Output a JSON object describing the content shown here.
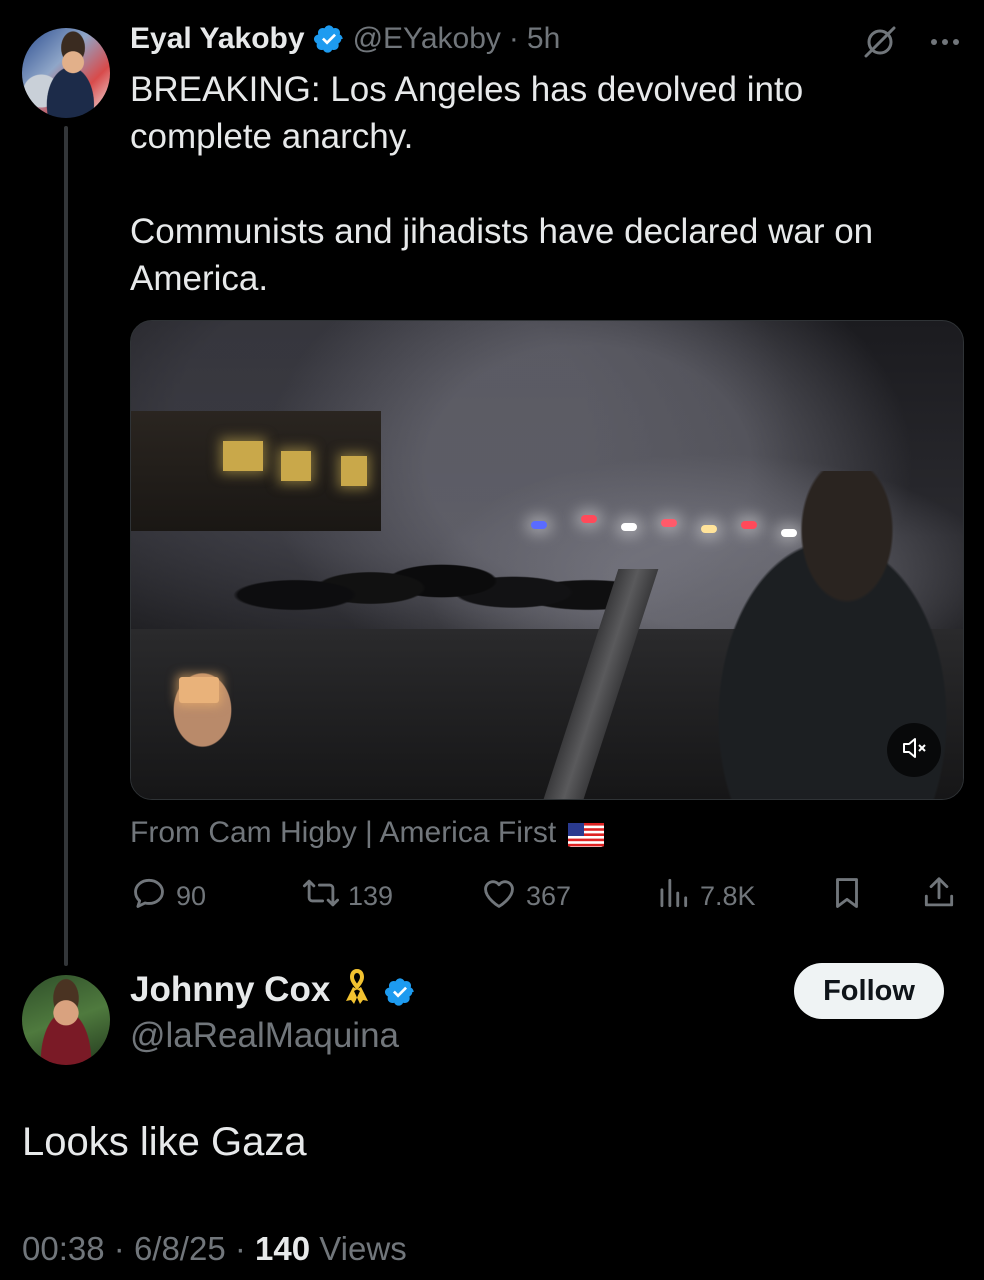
{
  "tweet1": {
    "author_name": "Eyal Yakoby",
    "handle": "@EYakoby",
    "separator": "·",
    "time": "5h",
    "paragraph1": "BREAKING: Los Angeles has devolved into complete anarchy.",
    "paragraph2": "Communists and jihadists have declared war on America.",
    "media_icons": {
      "mute": "mute-icon"
    },
    "from_line": "From Cam Higby | America First",
    "from_flag": "us-flag-icon",
    "stats": {
      "replies": "90",
      "reposts": "139",
      "likes": "367",
      "views": "7.8K"
    },
    "icons": {
      "verified": "verified-badge-icon",
      "grok": "grok-icon",
      "more": "more-icon",
      "reply": "reply-icon",
      "repost": "repost-icon",
      "like": "like-icon",
      "views": "views-icon",
      "bookmark": "bookmark-icon",
      "share": "share-icon"
    }
  },
  "tweet2": {
    "author_name": "Johnny Cox",
    "ribbon_icon": "yellow-ribbon-icon",
    "handle": "@laRealMaquina",
    "follow_label": "Follow",
    "text": "Looks like Gaza",
    "time": "00:38",
    "sep1": "·",
    "date": "6/8/25",
    "sep2": "·",
    "views_count": "140",
    "views_label": "Views"
  },
  "colors": {
    "background": "#000000",
    "text_primary": "#e7e9ea",
    "text_secondary": "#71767b",
    "verified_blue": "#1d9bf0",
    "ribbon_yellow": "#f2c230",
    "follow_bg": "#eff3f4"
  }
}
